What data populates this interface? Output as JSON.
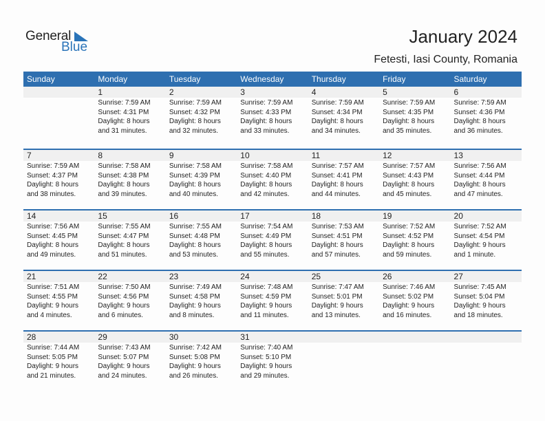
{
  "logo": {
    "line1": "General",
    "line2": "Blue"
  },
  "header": {
    "title": "January 2024",
    "subtitle": "Fetesti, Iasi County, Romania"
  },
  "colors": {
    "accent": "#2e6fb0",
    "band": "#f0f0f0"
  },
  "weekdays": [
    "Sunday",
    "Monday",
    "Tuesday",
    "Wednesday",
    "Thursday",
    "Friday",
    "Saturday"
  ],
  "weeks": [
    [
      null,
      {
        "day": "1",
        "sunrise": "Sunrise: 7:59 AM",
        "sunset": "Sunset: 4:31 PM",
        "daylight1": "Daylight: 8 hours",
        "daylight2": "and 31 minutes."
      },
      {
        "day": "2",
        "sunrise": "Sunrise: 7:59 AM",
        "sunset": "Sunset: 4:32 PM",
        "daylight1": "Daylight: 8 hours",
        "daylight2": "and 32 minutes."
      },
      {
        "day": "3",
        "sunrise": "Sunrise: 7:59 AM",
        "sunset": "Sunset: 4:33 PM",
        "daylight1": "Daylight: 8 hours",
        "daylight2": "and 33 minutes."
      },
      {
        "day": "4",
        "sunrise": "Sunrise: 7:59 AM",
        "sunset": "Sunset: 4:34 PM",
        "daylight1": "Daylight: 8 hours",
        "daylight2": "and 34 minutes."
      },
      {
        "day": "5",
        "sunrise": "Sunrise: 7:59 AM",
        "sunset": "Sunset: 4:35 PM",
        "daylight1": "Daylight: 8 hours",
        "daylight2": "and 35 minutes."
      },
      {
        "day": "6",
        "sunrise": "Sunrise: 7:59 AM",
        "sunset": "Sunset: 4:36 PM",
        "daylight1": "Daylight: 8 hours",
        "daylight2": "and 36 minutes."
      }
    ],
    [
      {
        "day": "7",
        "sunrise": "Sunrise: 7:59 AM",
        "sunset": "Sunset: 4:37 PM",
        "daylight1": "Daylight: 8 hours",
        "daylight2": "and 38 minutes."
      },
      {
        "day": "8",
        "sunrise": "Sunrise: 7:58 AM",
        "sunset": "Sunset: 4:38 PM",
        "daylight1": "Daylight: 8 hours",
        "daylight2": "and 39 minutes."
      },
      {
        "day": "9",
        "sunrise": "Sunrise: 7:58 AM",
        "sunset": "Sunset: 4:39 PM",
        "daylight1": "Daylight: 8 hours",
        "daylight2": "and 40 minutes."
      },
      {
        "day": "10",
        "sunrise": "Sunrise: 7:58 AM",
        "sunset": "Sunset: 4:40 PM",
        "daylight1": "Daylight: 8 hours",
        "daylight2": "and 42 minutes."
      },
      {
        "day": "11",
        "sunrise": "Sunrise: 7:57 AM",
        "sunset": "Sunset: 4:41 PM",
        "daylight1": "Daylight: 8 hours",
        "daylight2": "and 44 minutes."
      },
      {
        "day": "12",
        "sunrise": "Sunrise: 7:57 AM",
        "sunset": "Sunset: 4:43 PM",
        "daylight1": "Daylight: 8 hours",
        "daylight2": "and 45 minutes."
      },
      {
        "day": "13",
        "sunrise": "Sunrise: 7:56 AM",
        "sunset": "Sunset: 4:44 PM",
        "daylight1": "Daylight: 8 hours",
        "daylight2": "and 47 minutes."
      }
    ],
    [
      {
        "day": "14",
        "sunrise": "Sunrise: 7:56 AM",
        "sunset": "Sunset: 4:45 PM",
        "daylight1": "Daylight: 8 hours",
        "daylight2": "and 49 minutes."
      },
      {
        "day": "15",
        "sunrise": "Sunrise: 7:55 AM",
        "sunset": "Sunset: 4:47 PM",
        "daylight1": "Daylight: 8 hours",
        "daylight2": "and 51 minutes."
      },
      {
        "day": "16",
        "sunrise": "Sunrise: 7:55 AM",
        "sunset": "Sunset: 4:48 PM",
        "daylight1": "Daylight: 8 hours",
        "daylight2": "and 53 minutes."
      },
      {
        "day": "17",
        "sunrise": "Sunrise: 7:54 AM",
        "sunset": "Sunset: 4:49 PM",
        "daylight1": "Daylight: 8 hours",
        "daylight2": "and 55 minutes."
      },
      {
        "day": "18",
        "sunrise": "Sunrise: 7:53 AM",
        "sunset": "Sunset: 4:51 PM",
        "daylight1": "Daylight: 8 hours",
        "daylight2": "and 57 minutes."
      },
      {
        "day": "19",
        "sunrise": "Sunrise: 7:52 AM",
        "sunset": "Sunset: 4:52 PM",
        "daylight1": "Daylight: 8 hours",
        "daylight2": "and 59 minutes."
      },
      {
        "day": "20",
        "sunrise": "Sunrise: 7:52 AM",
        "sunset": "Sunset: 4:54 PM",
        "daylight1": "Daylight: 9 hours",
        "daylight2": "and 1 minute."
      }
    ],
    [
      {
        "day": "21",
        "sunrise": "Sunrise: 7:51 AM",
        "sunset": "Sunset: 4:55 PM",
        "daylight1": "Daylight: 9 hours",
        "daylight2": "and 4 minutes."
      },
      {
        "day": "22",
        "sunrise": "Sunrise: 7:50 AM",
        "sunset": "Sunset: 4:56 PM",
        "daylight1": "Daylight: 9 hours",
        "daylight2": "and 6 minutes."
      },
      {
        "day": "23",
        "sunrise": "Sunrise: 7:49 AM",
        "sunset": "Sunset: 4:58 PM",
        "daylight1": "Daylight: 9 hours",
        "daylight2": "and 8 minutes."
      },
      {
        "day": "24",
        "sunrise": "Sunrise: 7:48 AM",
        "sunset": "Sunset: 4:59 PM",
        "daylight1": "Daylight: 9 hours",
        "daylight2": "and 11 minutes."
      },
      {
        "day": "25",
        "sunrise": "Sunrise: 7:47 AM",
        "sunset": "Sunset: 5:01 PM",
        "daylight1": "Daylight: 9 hours",
        "daylight2": "and 13 minutes."
      },
      {
        "day": "26",
        "sunrise": "Sunrise: 7:46 AM",
        "sunset": "Sunset: 5:02 PM",
        "daylight1": "Daylight: 9 hours",
        "daylight2": "and 16 minutes."
      },
      {
        "day": "27",
        "sunrise": "Sunrise: 7:45 AM",
        "sunset": "Sunset: 5:04 PM",
        "daylight1": "Daylight: 9 hours",
        "daylight2": "and 18 minutes."
      }
    ],
    [
      {
        "day": "28",
        "sunrise": "Sunrise: 7:44 AM",
        "sunset": "Sunset: 5:05 PM",
        "daylight1": "Daylight: 9 hours",
        "daylight2": "and 21 minutes."
      },
      {
        "day": "29",
        "sunrise": "Sunrise: 7:43 AM",
        "sunset": "Sunset: 5:07 PM",
        "daylight1": "Daylight: 9 hours",
        "daylight2": "and 24 minutes."
      },
      {
        "day": "30",
        "sunrise": "Sunrise: 7:42 AM",
        "sunset": "Sunset: 5:08 PM",
        "daylight1": "Daylight: 9 hours",
        "daylight2": "and 26 minutes."
      },
      {
        "day": "31",
        "sunrise": "Sunrise: 7:40 AM",
        "sunset": "Sunset: 5:10 PM",
        "daylight1": "Daylight: 9 hours",
        "daylight2": "and 29 minutes."
      },
      null,
      null,
      null
    ]
  ]
}
